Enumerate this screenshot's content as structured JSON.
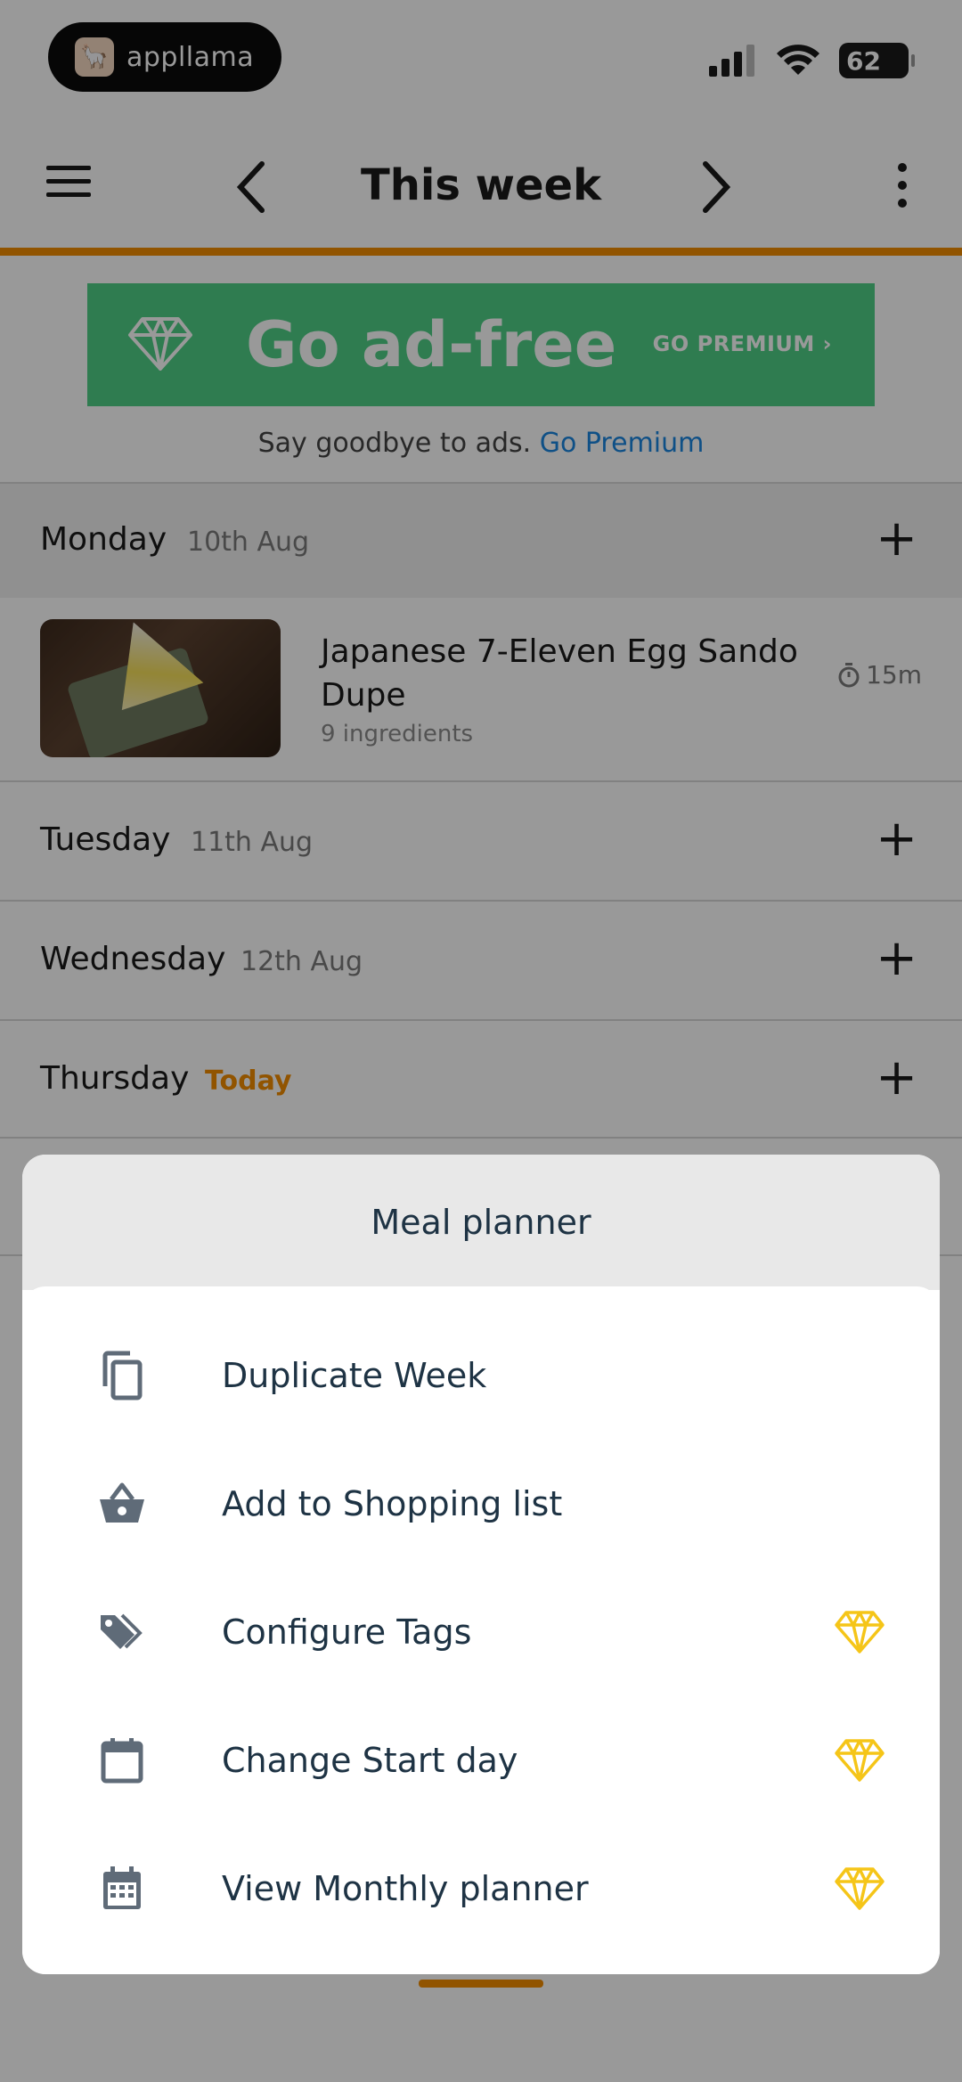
{
  "status_bar": {
    "brand": "appllama",
    "battery": "62"
  },
  "app_bar": {
    "title": "This week"
  },
  "promo": {
    "title": "Go ad-free",
    "cta": "GO PREMIUM",
    "subtitle": "Say goodbye to ads.",
    "link": "Go Premium",
    "color": "#4fcf86"
  },
  "days": [
    {
      "name": "Monday",
      "date": "10th Aug"
    },
    {
      "name": "Tuesday",
      "date": "11th Aug"
    },
    {
      "name": "Wednesday",
      "date": "12th Aug"
    },
    {
      "name": "Thursday",
      "date": "Today"
    }
  ],
  "recipe": {
    "title": "Japanese 7-Eleven Egg Sando Dupe",
    "ingredients": "9 ingredients",
    "time": "15m"
  },
  "sheet": {
    "title": "Meal planner",
    "items": [
      {
        "label": "Duplicate Week",
        "icon": "copy-icon",
        "premium": false
      },
      {
        "label": "Add to Shopping list",
        "icon": "basket-icon",
        "premium": false
      },
      {
        "label": "Configure Tags",
        "icon": "tag-icon",
        "premium": true
      },
      {
        "label": "Change Start day",
        "icon": "calendar-icon",
        "premium": true
      },
      {
        "label": "View Monthly planner",
        "icon": "calendar-month-icon",
        "premium": true
      }
    ]
  },
  "colors": {
    "accent": "#f28c00",
    "premium_gem": "#f5c518",
    "text_dark": "#1e3344",
    "link": "#1a85e0"
  }
}
